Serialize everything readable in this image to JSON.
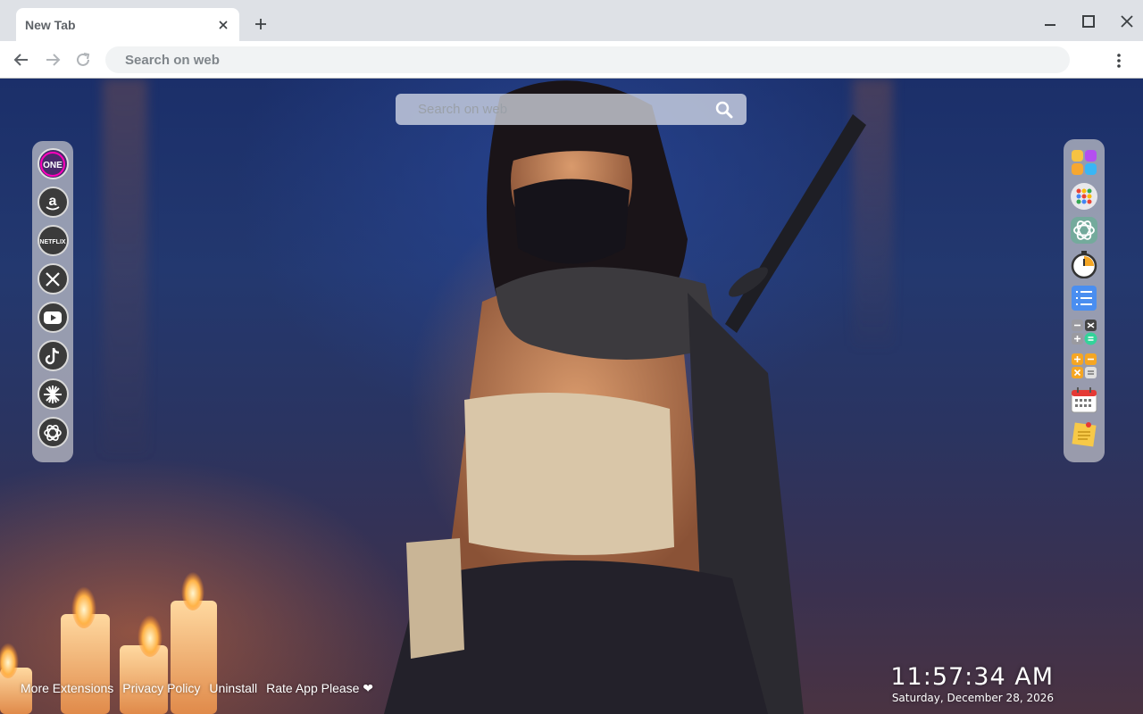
{
  "browser": {
    "tab_title": "New Tab",
    "omnibox_placeholder": "Search on web"
  },
  "colors": {
    "chrome_bg": "#dee1e6",
    "toolbar_bg": "#ffffff",
    "omnibox_bg": "#f1f3f4",
    "dock_bg": "#c8c8cd"
  },
  "page": {
    "search": {
      "placeholder": "Search on web",
      "icon": "search-icon"
    },
    "left_dock": [
      {
        "name": "one",
        "icon": "one-logo-icon"
      },
      {
        "name": "amazon",
        "icon": "amazon-icon"
      },
      {
        "name": "netflix",
        "icon": "netflix-icon"
      },
      {
        "name": "x",
        "icon": "x-icon"
      },
      {
        "name": "youtube",
        "icon": "youtube-icon"
      },
      {
        "name": "tiktok",
        "icon": "tiktok-icon"
      },
      {
        "name": "perplexity",
        "icon": "starburst-icon"
      },
      {
        "name": "chatgpt",
        "icon": "chatgpt-icon"
      }
    ],
    "right_dock": [
      {
        "name": "apps",
        "icon": "apps-grid-icon"
      },
      {
        "name": "launcher",
        "icon": "dots-grid-icon"
      },
      {
        "name": "chatgpt",
        "icon": "chatgpt-icon"
      },
      {
        "name": "timer",
        "icon": "stopwatch-icon"
      },
      {
        "name": "todo",
        "icon": "checklist-icon"
      },
      {
        "name": "calculator",
        "icon": "calculator-icon"
      },
      {
        "name": "calculator-alt",
        "icon": "calculator-orange-icon"
      },
      {
        "name": "calendar",
        "icon": "calendar-icon"
      },
      {
        "name": "notes",
        "icon": "sticky-note-icon"
      }
    ],
    "footer": {
      "more_extensions": "More Extensions",
      "privacy_policy": "Privacy Policy",
      "uninstall": "Uninstall",
      "rate_app": "Rate App Please ❤"
    },
    "clock": {
      "time": "11:57:34 AM",
      "date": "Saturday, December 28, 2026"
    }
  }
}
